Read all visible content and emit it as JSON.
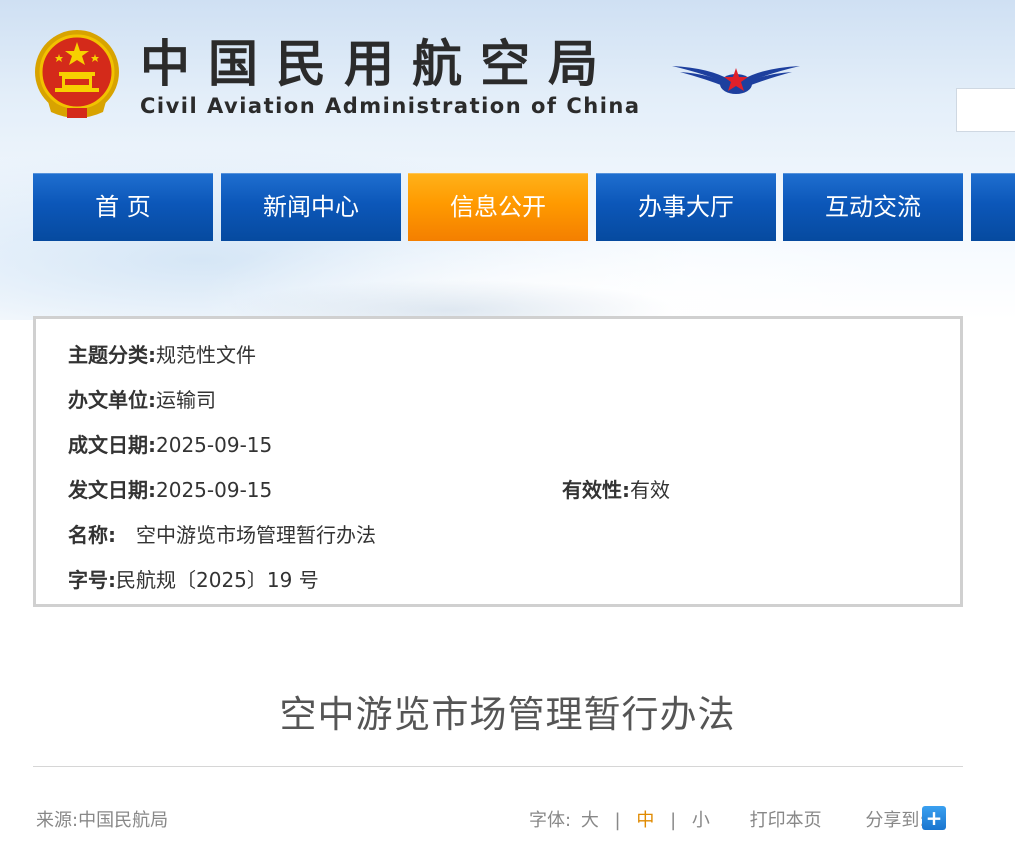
{
  "header": {
    "title_cn": "中国民用航空局",
    "title_en": "Civil Aviation Administration of China",
    "emblem_icon": "national-emblem-icon",
    "wings_icon": "caac-wings-logo-icon"
  },
  "nav": {
    "items": [
      {
        "label": "首 页",
        "active": false
      },
      {
        "label": "新闻中心",
        "active": false
      },
      {
        "label": "信息公开",
        "active": true
      },
      {
        "label": "办事大厅",
        "active": false
      },
      {
        "label": "互动交流",
        "active": false
      },
      {
        "label": "",
        "active": false
      }
    ]
  },
  "info": {
    "topic_label": "主题分类:",
    "topic_value": "规范性文件",
    "unit_label": "办文单位:",
    "unit_value": "运输司",
    "written_label": "成文日期:",
    "written_value": "2025-09-15",
    "issued_label": "发文日期:",
    "issued_value": "2025-09-15",
    "validity_label": "有效性:",
    "validity_value": "有效",
    "name_label": "名称:",
    "name_value": "空中游览市场管理暂行办法",
    "number_label": "字号:",
    "number_value": "民航规〔2025〕19 号"
  },
  "document": {
    "title": "空中游览市场管理暂行办法"
  },
  "footer": {
    "source": "来源:中国民航局",
    "font_label": "字体:",
    "font_large": "大",
    "font_sep1": "|",
    "font_medium": "中",
    "font_sep2": "|",
    "font_small": "小",
    "print": "打印本页",
    "share_label": "分享到:",
    "share_icon_glyph": "+"
  },
  "colors": {
    "nav_blue": "#0c57b9",
    "nav_active_orange": "#ff9a00",
    "font_active": "#e08a00"
  }
}
